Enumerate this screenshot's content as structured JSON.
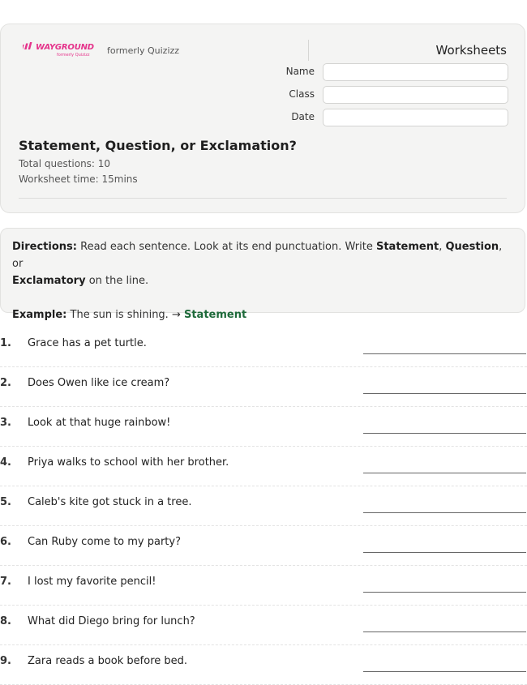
{
  "header": {
    "logo_text": "WAYGROUND",
    "logo_sub": "formerly Quizizz",
    "formerly_text": "formerly Quizizz",
    "worksheets_label": "Worksheets",
    "fields": [
      {
        "label": "Name",
        "value": ""
      },
      {
        "label": "Class",
        "value": ""
      },
      {
        "label": "Date",
        "value": ""
      }
    ],
    "title": "Statement, Question, or Exclamation?",
    "total_questions": "Total questions: 10",
    "worksheet_time": "Worksheet time: 15mins"
  },
  "directions": {
    "label": "Directions:",
    "text_1": " Read each sentence. Look at its end punctuation. Write ",
    "option_1": "Statement",
    "sep_1": ", ",
    "option_2": "Question",
    "sep_2": ", or",
    "option_3": "Exclamatory",
    "text_2": " on the line.",
    "example_label": "Example:",
    "example_text": " The sun is shining. → ",
    "example_answer": "Statement"
  },
  "questions": [
    {
      "num": "1.",
      "text": "Grace has a pet turtle."
    },
    {
      "num": "2.",
      "text": "Does Owen like ice cream?"
    },
    {
      "num": "3.",
      "text": "Look at that huge rainbow!"
    },
    {
      "num": "4.",
      "text": "Priya walks to school with her brother."
    },
    {
      "num": "5.",
      "text": "Caleb's kite got stuck in a tree."
    },
    {
      "num": "6.",
      "text": "Can Ruby come to my party?"
    },
    {
      "num": "7.",
      "text": "I lost my favorite pencil!"
    },
    {
      "num": "8.",
      "text": "What did Diego bring for lunch?"
    },
    {
      "num": "9.",
      "text": "Zara reads a book before bed."
    }
  ],
  "colors": {
    "brand": "#e5338b",
    "example_answer": "#1e6a3a"
  }
}
